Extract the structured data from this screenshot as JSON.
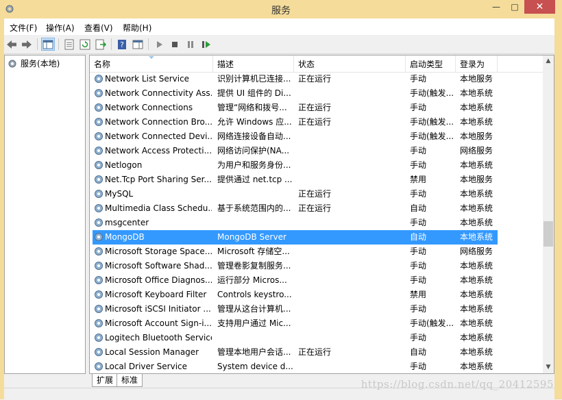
{
  "window": {
    "title": "服务",
    "minimize": "—",
    "maximize": "□",
    "close": "✕"
  },
  "menu": [
    "文件(F)",
    "操作(A)",
    "查看(V)",
    "帮助(H)"
  ],
  "tree": {
    "root_label": "服务(本地)"
  },
  "columns": {
    "name": "名称",
    "desc": "描述",
    "status": "状态",
    "startup": "启动类型",
    "logon": "登录为"
  },
  "services": [
    {
      "name": "Network List Service",
      "desc": "识别计算机已连接...",
      "status": "正在运行",
      "startup": "手动",
      "logon": "本地服务"
    },
    {
      "name": "Network Connectivity Ass...",
      "desc": "提供 UI 组件的 Di...",
      "status": "",
      "startup": "手动(触发...",
      "logon": "本地系统"
    },
    {
      "name": "Network Connections",
      "desc": "管理“网络和拨号...",
      "status": "正在运行",
      "startup": "手动",
      "logon": "本地系统"
    },
    {
      "name": "Network Connection Bro...",
      "desc": "允许 Windows 应...",
      "status": "正在运行",
      "startup": "手动(触发...",
      "logon": "本地系统"
    },
    {
      "name": "Network Connected Devi...",
      "desc": "网络连接设备自动...",
      "status": "",
      "startup": "手动(触发...",
      "logon": "本地服务"
    },
    {
      "name": "Network Access Protecti...",
      "desc": "网络访问保护(NA...",
      "status": "",
      "startup": "手动",
      "logon": "网络服务"
    },
    {
      "name": "Netlogon",
      "desc": "为用户和服务身份...",
      "status": "",
      "startup": "手动",
      "logon": "本地系统"
    },
    {
      "name": "Net.Tcp Port Sharing Ser...",
      "desc": "提供通过 net.tcp ...",
      "status": "",
      "startup": "禁用",
      "logon": "本地服务"
    },
    {
      "name": "MySQL",
      "desc": "",
      "status": "正在运行",
      "startup": "手动",
      "logon": "本地系统"
    },
    {
      "name": "Multimedia Class Schedu...",
      "desc": "基于系统范围内的...",
      "status": "正在运行",
      "startup": "自动",
      "logon": "本地系统"
    },
    {
      "name": "msgcenter",
      "desc": "",
      "status": "",
      "startup": "手动",
      "logon": "本地系统"
    },
    {
      "name": "MongoDB",
      "desc": "MongoDB Server",
      "status": "",
      "startup": "自动",
      "logon": "本地系统",
      "selected": true
    },
    {
      "name": "Microsoft Storage Space...",
      "desc": "Microsoft 存储空...",
      "status": "",
      "startup": "手动",
      "logon": "网络服务"
    },
    {
      "name": "Microsoft Software Shad...",
      "desc": "管理卷影复制服务...",
      "status": "",
      "startup": "手动",
      "logon": "本地系统"
    },
    {
      "name": "Microsoft Office Diagnos...",
      "desc": "运行部分 Micros...",
      "status": "",
      "startup": "手动",
      "logon": "本地系统"
    },
    {
      "name": "Microsoft Keyboard Filter",
      "desc": "Controls keystro...",
      "status": "",
      "startup": "禁用",
      "logon": "本地系统"
    },
    {
      "name": "Microsoft iSCSI Initiator ...",
      "desc": "管理从这台计算机...",
      "status": "",
      "startup": "手动",
      "logon": "本地系统"
    },
    {
      "name": "Microsoft Account Sign-i...",
      "desc": "支持用户通过 Mic...",
      "status": "",
      "startup": "手动(触发...",
      "logon": "本地系统"
    },
    {
      "name": "Logitech Bluetooth Service",
      "desc": "",
      "status": "",
      "startup": "手动",
      "logon": "本地系统"
    },
    {
      "name": "Local Session Manager",
      "desc": "管理本地用户会话...",
      "status": "正在运行",
      "startup": "自动",
      "logon": "本地系统"
    },
    {
      "name": "Local Driver Service",
      "desc": "System device d...",
      "status": "",
      "startup": "手动",
      "logon": "本地系统"
    }
  ],
  "tabs": [
    "扩展",
    "标准"
  ],
  "watermark": "https://blog.csdn.net/qq_20412595",
  "colors": {
    "title_bar": "#f5dc9a",
    "selection": "#3399ff",
    "close_button": "#c75050"
  }
}
